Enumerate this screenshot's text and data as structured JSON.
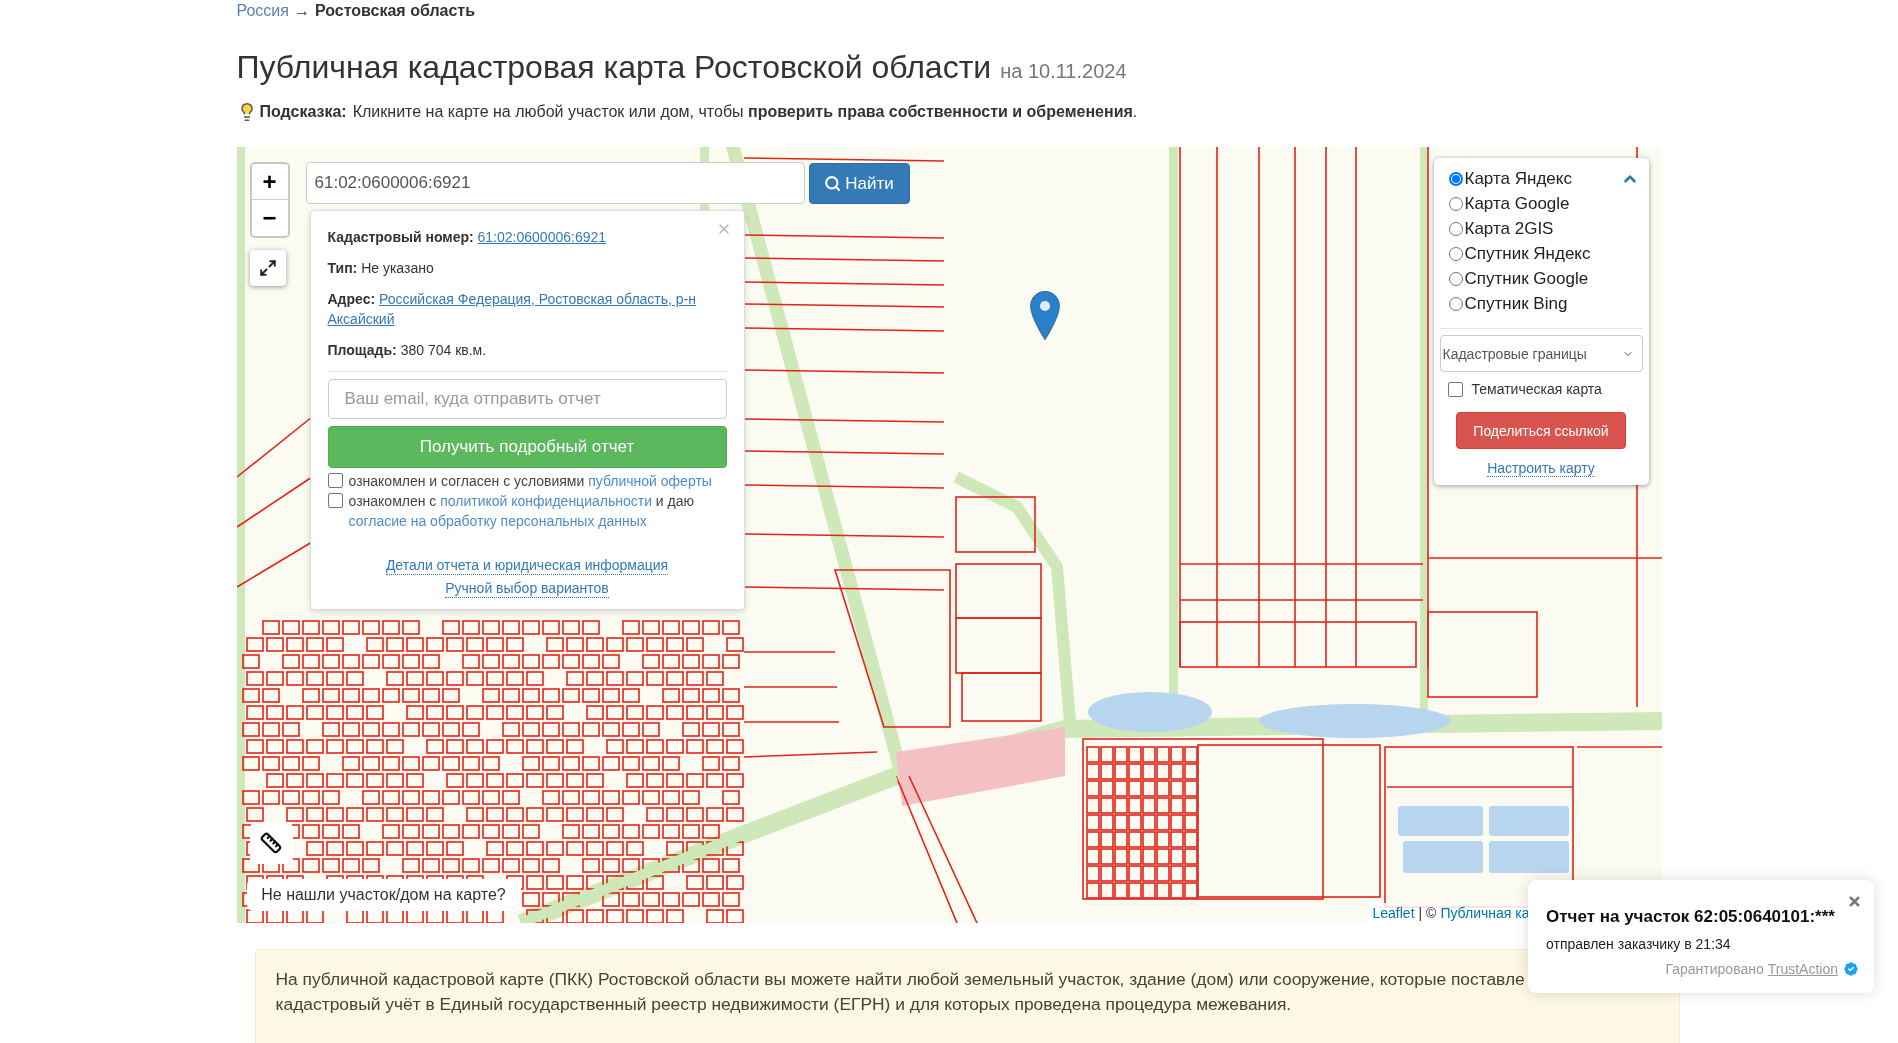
{
  "breadcrumb": {
    "link": "Россия",
    "separator": "→",
    "current": "Ростовская область"
  },
  "heading": {
    "title": "Публичная кадастровая карта Ростовской области",
    "date": "на 10.11.2024"
  },
  "hint": {
    "label": "Подсказка:",
    "text": "Кликните на карте на любой участок или дом, чтобы **проверить права собственности и обременения**."
  },
  "map": {
    "zoom_buttons": [
      "+",
      "−"
    ],
    "search": {
      "value": "61:02:0600006:6921",
      "button": "Найти"
    },
    "popup": {
      "fields": [
        {
          "label": "Кадастровый номер:",
          "value": "61:02:0600006:6921",
          "kind": "link"
        },
        {
          "label": "Тип:",
          "value": "Не указано",
          "kind": "text"
        },
        {
          "label": "Адрес:",
          "value": "Российская Федерация, Ростовская область, р-н Аксайский",
          "kind": "link"
        },
        {
          "label": "Площадь:",
          "value": "380 704 кв.м.",
          "kind": "text"
        }
      ],
      "email": {
        "placeholder": "Ваш email, куда отправить отчет"
      },
      "submit_button": "Получить подробный отчет",
      "agreements": [
        {
          "checked": false,
          "parts": [
            {
              "kind": "text",
              "text": "ознакомлен и согласен с условиями"
            },
            {
              "kind": "link",
              "text": "публичной оферты"
            }
          ]
        },
        {
          "checked": false,
          "parts": [
            {
              "kind": "text",
              "text": "ознакомлен с"
            },
            {
              "kind": "link",
              "text": "политикой конфиденциальности"
            },
            {
              "kind": "text",
              "text": "и даю"
            },
            {
              "kind": "link",
              "text": "согласие на обработку персональных данных"
            }
          ]
        }
      ],
      "links": [
        "Детали отчета и юридическая информация",
        "Ручной выбор вариантов"
      ]
    },
    "layers": {
      "expanded": true,
      "base_layers": [
        {
          "label": "Карта Яндекс",
          "selected": true
        },
        {
          "label": "Карта Google",
          "selected": false
        },
        {
          "label": "Карта 2GIS",
          "selected": false
        },
        {
          "label": "Спутник Яндекс",
          "selected": false
        },
        {
          "label": "Спутник Google",
          "selected": false
        },
        {
          "label": "Спутник Bing",
          "selected": false
        }
      ],
      "overlay_select": {
        "value": "Кадастровые границы"
      },
      "thematic": {
        "label": "Тематическая карта",
        "checked": false
      },
      "share_button": "Поделиться ссылкой",
      "settings_link": "Настроить карту"
    },
    "not_found_button": "Не нашли участок/дом на карте?",
    "attribution": [
      {
        "kind": "link",
        "text": "Leaflet"
      },
      {
        "kind": "text",
        "text": "| ©"
      },
      {
        "kind": "link",
        "text": "Публичная ка"
      }
    ]
  },
  "notification": {
    "title": "Отчет на участок 62:05:0640101:***",
    "text": "отправлен заказчику в 21:34",
    "guarantee": "Гарантировано",
    "brand": "TrustAction"
  },
  "info": {
    "lines": [
      "На публичной кадастровой карте (ПКК) Ростовской области вы можете найти любой земельный участок, здание (дом) или сооружение, которые поставле",
      "кадастровый учёт в Единый государственный реестр недвижимости (ЕГРН) и для которых проведена процедура межевания."
    ]
  }
}
